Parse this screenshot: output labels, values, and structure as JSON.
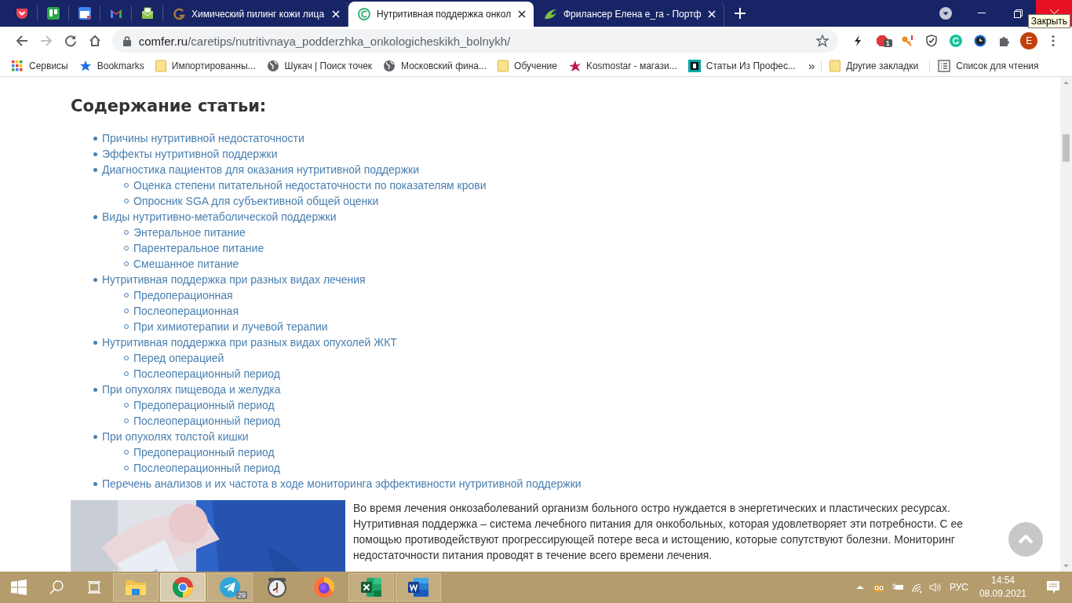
{
  "tabs": [
    {
      "kind": "pocket",
      "selected": false
    },
    {
      "kind": "trello",
      "selected": false
    },
    {
      "kind": "calendar",
      "selected": false
    },
    {
      "kind": "mail",
      "selected": false
    },
    {
      "kind": "envelope",
      "selected": false
    },
    {
      "kind": "letter",
      "label": "Химический пилинг кожи лица",
      "selected": false
    },
    {
      "kind": "ring",
      "label": "Нутритивная поддержка онкол",
      "selected": true
    },
    {
      "kind": "leaf",
      "label": "Фрилансер Елена e_ra - Портф",
      "selected": false
    }
  ],
  "tooltip": "Закрыть",
  "address": {
    "host": "comfer.ru",
    "path": "/caretips/nutritivnaya_podderzhka_onkologicheskikh_bolnykh/"
  },
  "extensions": {
    "badge": "1",
    "avatar": "E"
  },
  "bookmarks": [
    {
      "kind": "apps",
      "label": "Сервисы"
    },
    {
      "kind": "star",
      "label": "Bookmarks"
    },
    {
      "kind": "folder",
      "label": "Импортированны..."
    },
    {
      "kind": "globe",
      "label": "Шукач | Поиск точек"
    },
    {
      "kind": "globe",
      "label": "Московский фина..."
    },
    {
      "kind": "folder",
      "label": "Обучение"
    },
    {
      "kind": "pinkstar",
      "label": "Kosmostar - магази..."
    },
    {
      "kind": "teal",
      "label": "Статьи Из Профес..."
    }
  ],
  "bookmarks_more": "»",
  "bookmarks_right": [
    {
      "kind": "folder",
      "label": "Другие закладки"
    },
    {
      "kind": "list",
      "label": "Список для чтения"
    }
  ],
  "article": {
    "heading": "Содержание статьи:",
    "toc": [
      {
        "label": "Причины нутритивной недостаточности"
      },
      {
        "label": "Эффекты нутритивной поддержки"
      },
      {
        "label": "Диагностика пациентов для оказания нутритивной поддержки",
        "children": [
          {
            "label": "Оценка степени питательной недостаточности по показателям крови"
          },
          {
            "label": "Опросник SGA для субъективной общей оценки"
          }
        ]
      },
      {
        "label": "Виды нутритивно-метаболической поддержки",
        "children": [
          {
            "label": "Энтеральное питание"
          },
          {
            "label": "Парентеральное питание"
          },
          {
            "label": "Смешанное питание"
          }
        ]
      },
      {
        "label": "Нутритивная поддержка при разных видах лечения",
        "children": [
          {
            "label": "Предоперационная"
          },
          {
            "label": "Послеоперационная"
          },
          {
            "label": "При химиотерапии и лучевой терапии"
          }
        ]
      },
      {
        "label": "Нутритивная поддержка при разных видах опухолей ЖКТ",
        "children": [
          {
            "label": "Перед операцией"
          },
          {
            "label": "Послеоперационный период"
          }
        ]
      },
      {
        "label": "При опухолях пищевода и желудка",
        "children": [
          {
            "label": "Предоперационный период"
          },
          {
            "label": "Послеоперационный период"
          }
        ]
      },
      {
        "label": "При опухолях толстой кишки",
        "children": [
          {
            "label": "Предоперационный период"
          },
          {
            "label": "Послеоперационный период"
          }
        ]
      },
      {
        "label": "Перечень анализов и их частота в ходе мониторинга эффективности нутритивной поддержки"
      }
    ],
    "paragraph": "Во время лечения онкозаболеваний организм больного остро нуждается в энергетических и пластических ресурсах. Нутритивная поддержка – система лечебного питания для онкобольных, которая удовлетворяет эти потребности. С ее помощью противодействуют прогрессирующей потере веса и истощению, которые сопутствуют болезни. Мониторинг недостаточности питания проводят в течение всего времени лечения."
  },
  "taskbar": {
    "apps": [
      {
        "kind": "explorer",
        "running": true,
        "selected": false
      },
      {
        "kind": "chrome",
        "running": true,
        "selected": true
      },
      {
        "kind": "telegram",
        "running": true,
        "selected": false,
        "badge": "29"
      },
      {
        "kind": "clock",
        "running": false,
        "selected": false
      },
      {
        "kind": "firefox",
        "running": false,
        "selected": false
      },
      {
        "kind": "excel",
        "running": true,
        "selected": false
      },
      {
        "kind": "word",
        "running": true,
        "selected": false
      }
    ],
    "language": "РУС",
    "time": "14:54",
    "date": "08.09.2021"
  }
}
